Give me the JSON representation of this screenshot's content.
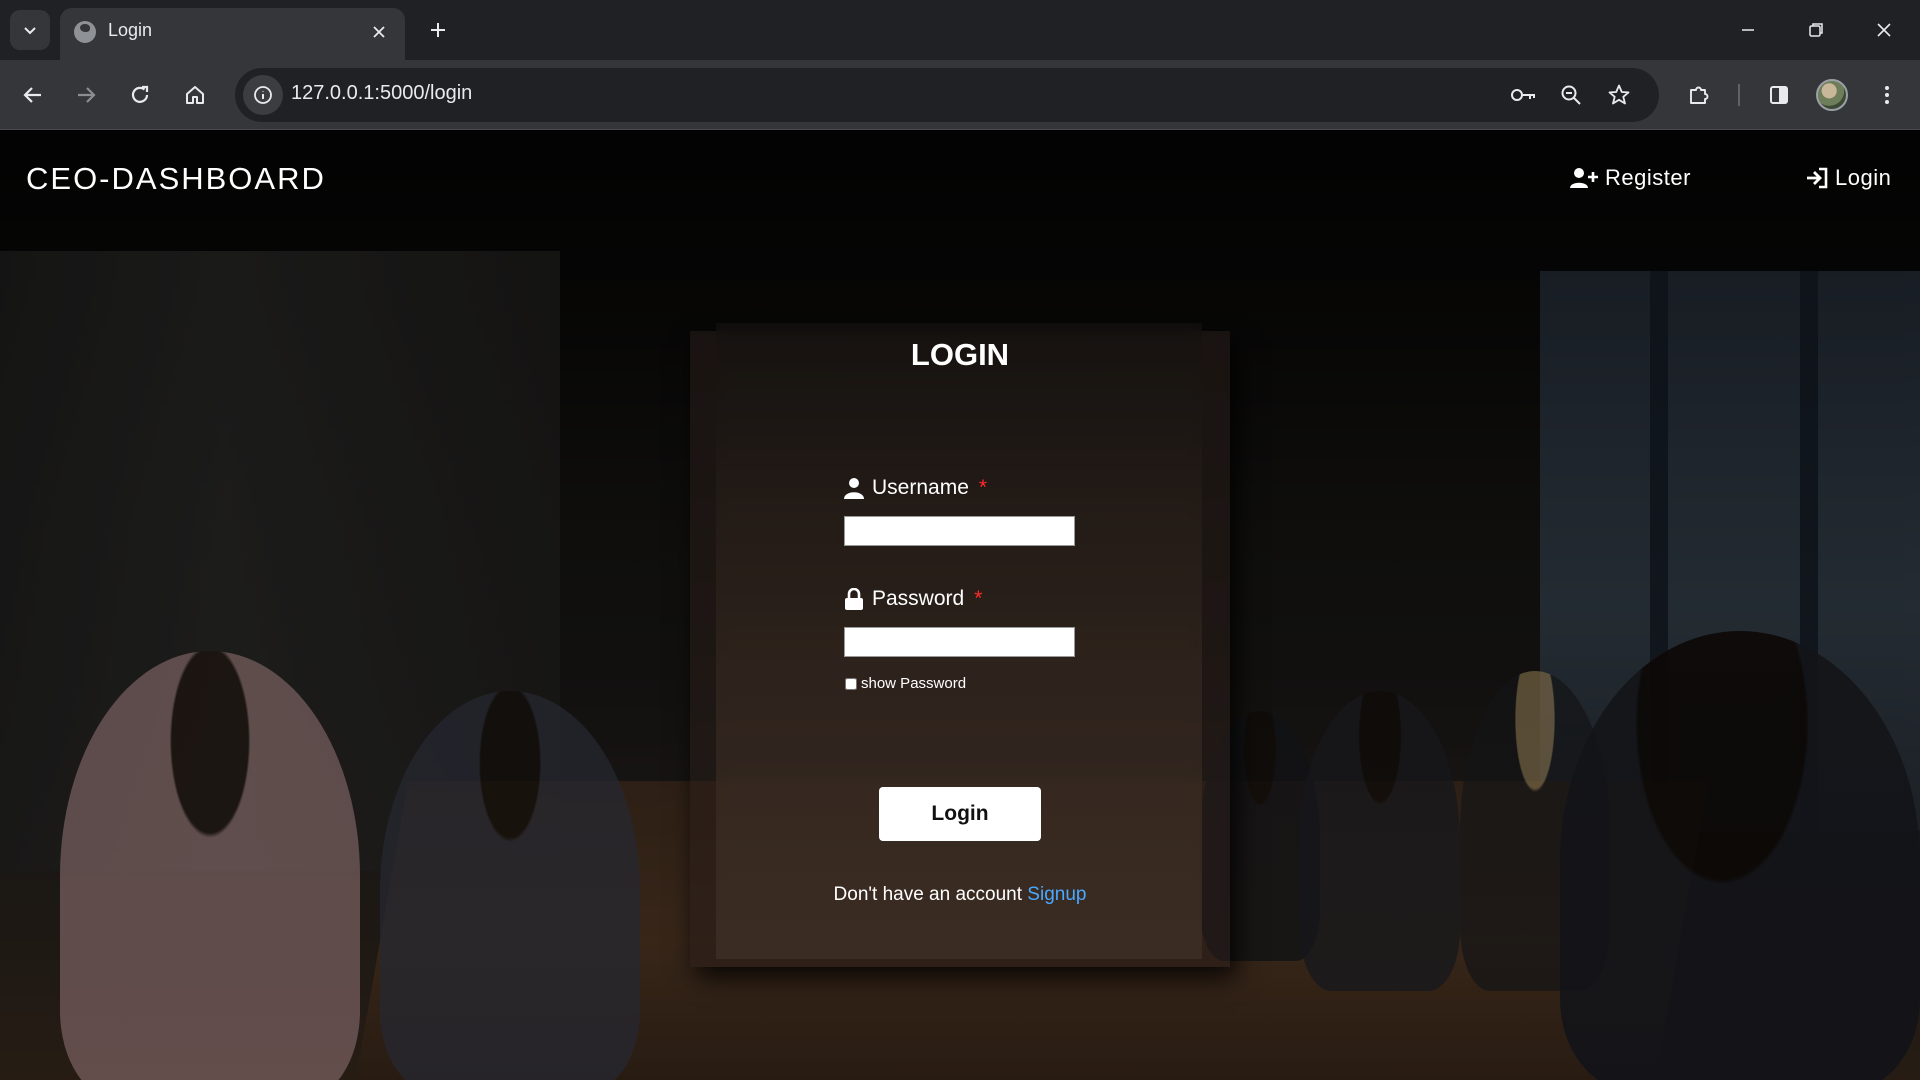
{
  "browser": {
    "tab_title": "Login",
    "url": "127.0.0.1:5000/login"
  },
  "navbar": {
    "brand": "CEO-DASHBOARD",
    "register_label": "Register",
    "login_label": "Login"
  },
  "form": {
    "title": "LOGIN",
    "username_label": "Username",
    "password_label": "Password",
    "required_marker": "*",
    "username_value": "",
    "password_value": "",
    "show_password_label": "show Password",
    "show_password_checked": false,
    "submit_label": "Login",
    "signup_prompt": "Don't have an account",
    "signup_link": "Signup"
  },
  "colors": {
    "required": "#ff2b2b",
    "link": "#4aa8ff",
    "chrome_dark": "#202124",
    "chrome_toolbar": "#35363a"
  },
  "icons": {
    "tab_search": "chevron-down-icon",
    "favicon": "globe-icon",
    "tab_close": "close-icon",
    "new_tab": "plus-icon",
    "back": "arrow-left-icon",
    "forward": "arrow-right-icon",
    "reload": "reload-icon",
    "home": "home-icon",
    "site_info": "info-icon",
    "password_manager": "key-icon",
    "zoom": "zoom-out-icon",
    "bookmark": "star-icon",
    "extensions": "puzzle-icon",
    "side_panel": "side-panel-icon",
    "menu": "kebab-menu-icon",
    "register": "user-plus-icon",
    "login": "sign-in-icon",
    "username": "user-icon",
    "password": "lock-icon"
  }
}
